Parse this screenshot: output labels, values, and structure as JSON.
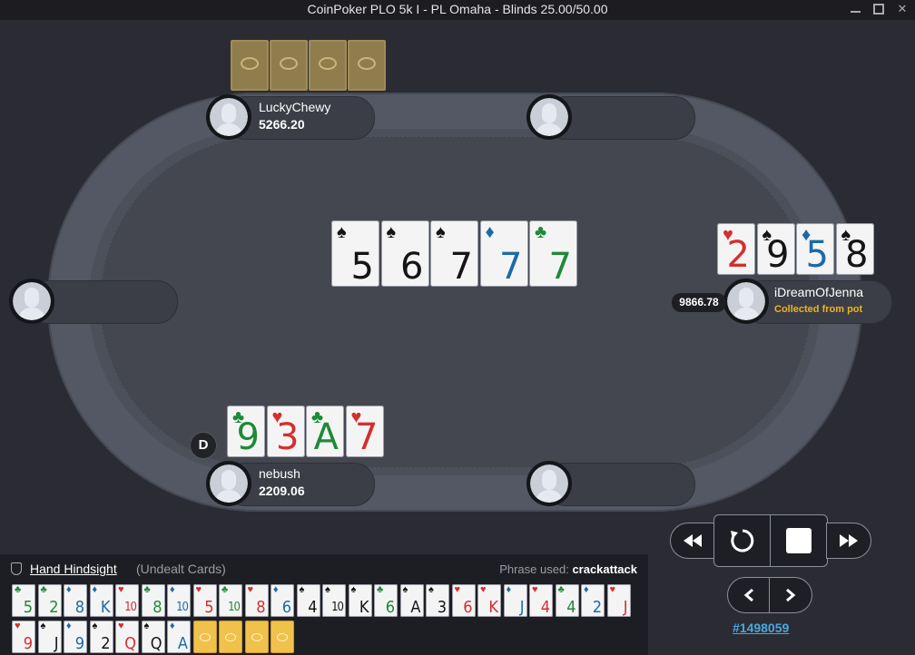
{
  "window": {
    "title": "CoinPoker PLO 5k I - PL Omaha - Blinds 25.00/50.00"
  },
  "players": {
    "lucky": {
      "name": "LuckyChewy",
      "stack": "5266.20"
    },
    "idream": {
      "name": "iDreamOfJenna",
      "stack_badge": "9866.78",
      "status": "Collected from pot"
    },
    "nebush": {
      "name": "nebush",
      "stack": "2209.06"
    }
  },
  "dealer_button": "D",
  "board": [
    {
      "rank": "5",
      "suit": "♠",
      "color": "blk"
    },
    {
      "rank": "6",
      "suit": "♠",
      "color": "blk"
    },
    {
      "rank": "7",
      "suit": "♠",
      "color": "blk"
    },
    {
      "rank": "7",
      "suit": "♦",
      "color": "blu"
    },
    {
      "rank": "7",
      "suit": "♣",
      "color": "grn"
    }
  ],
  "idream_hand": [
    {
      "rank": "2",
      "suit": "♥",
      "color": "red"
    },
    {
      "rank": "9",
      "suit": "♠",
      "color": "blk"
    },
    {
      "rank": "5",
      "suit": "♦",
      "color": "blu"
    },
    {
      "rank": "8",
      "suit": "♠",
      "color": "blk"
    }
  ],
  "nebush_hand": [
    {
      "rank": "9",
      "suit": "♣",
      "color": "grn"
    },
    {
      "rank": "3",
      "suit": "♥",
      "color": "red"
    },
    {
      "rank": "A",
      "suit": "♣",
      "color": "grn"
    },
    {
      "rank": "7",
      "suit": "♥",
      "color": "red"
    }
  ],
  "hindsight": {
    "title": "Hand Hindsight",
    "subtitle": "(Undealt Cards)",
    "phrase_label": "Phrase used:",
    "phrase": "crackattack",
    "row1": [
      {
        "rank": "5",
        "suit": "♣",
        "color": "grn"
      },
      {
        "rank": "2",
        "suit": "♣",
        "color": "grn"
      },
      {
        "rank": "8",
        "suit": "♦",
        "color": "blu"
      },
      {
        "rank": "K",
        "suit": "♦",
        "color": "blu"
      },
      {
        "rank": "10",
        "suit": "♥",
        "color": "red"
      },
      {
        "rank": "8",
        "suit": "♣",
        "color": "grn"
      },
      {
        "rank": "10",
        "suit": "♦",
        "color": "blu"
      },
      {
        "rank": "5",
        "suit": "♥",
        "color": "red"
      },
      {
        "rank": "10",
        "suit": "♣",
        "color": "grn"
      },
      {
        "rank": "8",
        "suit": "♥",
        "color": "red"
      },
      {
        "rank": "6",
        "suit": "♦",
        "color": "blu"
      },
      {
        "rank": "4",
        "suit": "♠",
        "color": "blk"
      },
      {
        "rank": "10",
        "suit": "♠",
        "color": "blk"
      },
      {
        "rank": "K",
        "suit": "♠",
        "color": "blk"
      },
      {
        "rank": "6",
        "suit": "♣",
        "color": "grn"
      },
      {
        "rank": "A",
        "suit": "♠",
        "color": "blk"
      },
      {
        "rank": "3",
        "suit": "♠",
        "color": "blk"
      },
      {
        "rank": "6",
        "suit": "♥",
        "color": "red"
      },
      {
        "rank": "K",
        "suit": "♥",
        "color": "red"
      },
      {
        "rank": "J",
        "suit": "♦",
        "color": "blu"
      },
      {
        "rank": "4",
        "suit": "♥",
        "color": "red"
      },
      {
        "rank": "4",
        "suit": "♣",
        "color": "grn"
      },
      {
        "rank": "2",
        "suit": "♦",
        "color": "blu"
      },
      {
        "rank": "J",
        "suit": "♥",
        "color": "red"
      }
    ],
    "row2": [
      {
        "rank": "9",
        "suit": "♥",
        "color": "red"
      },
      {
        "rank": "J",
        "suit": "♠",
        "color": "blk"
      },
      {
        "rank": "9",
        "suit": "♦",
        "color": "blu"
      },
      {
        "rank": "2",
        "suit": "♠",
        "color": "blk"
      },
      {
        "rank": "Q",
        "suit": "♥",
        "color": "red"
      },
      {
        "rank": "Q",
        "suit": "♠",
        "color": "blk"
      },
      {
        "rank": "A",
        "suit": "♦",
        "color": "blu"
      }
    ],
    "row2_backs": 4
  },
  "hand_id": "#1498059"
}
